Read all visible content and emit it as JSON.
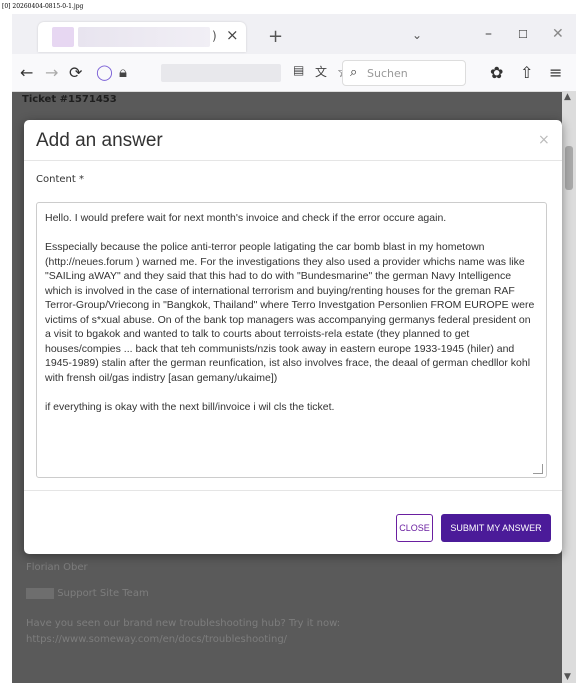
{
  "file_label": "[0] 20260404-0815-0-1.jpg",
  "browser": {
    "tab": {
      "title": ")",
      "close_icon": "close-icon"
    },
    "new_tab": "+",
    "window": {
      "minimize": "–",
      "maximize": "☐",
      "close": "✕"
    },
    "nav": {
      "back": "←",
      "forward": "→",
      "reload": "⟳"
    },
    "search": {
      "placeholder": "Suchen"
    }
  },
  "page": {
    "ticket_title": "Ticket #1571453",
    "bg_name": "Florian Ober",
    "bg_team": "Support Site Team",
    "bg_promo": "Have you seen our brand new troubleshooting hub? Try it now: https://www.someway.com/en/docs/troubleshooting/"
  },
  "modal": {
    "title": "Add an answer",
    "close_icon": "×",
    "content_label": "Content *",
    "answer": {
      "p1": "Hello. I would prefere wait for next month's invoice and check if the error occure again.",
      "p2": "Esspecially because the police anti-terror people latigating the car bomb blast in my hometown (http://neues.forum ) warned me. For the investigations they also used a provider whichs name was like \"SAILing aWAY\" and they said that this had to do with \"Bundesmarine\" the german Navy Intelligence which is involved in the case of international terrorism and buying/renting houses for the greman RAF Terror-Group/Vriecong in \"Bangkok, Thailand\" where Terro Investgation Personlien FROM EUROPE were victims of s*xual abuse. On of the bank top managers was accompanying germanys federal president on a visit to bgakok and wanted to talk to courts about terroists-rela estate (they planned to get houses/compies ... back that teh communists/nzis took away in eastern europe 1933-1945 (hiler) and 1945-1989) stalin after the german reunfication, ist also involves frace, the deaal of german chedllor kohl with frensh oil/gas indistry [asan gemany/ukaime])",
      "p3": "if everything is okay with the next bill/invoice i wil cls the ticket."
    },
    "close_button": "CLOSE",
    "submit_button": "SUBMIT MY ANSWER"
  }
}
